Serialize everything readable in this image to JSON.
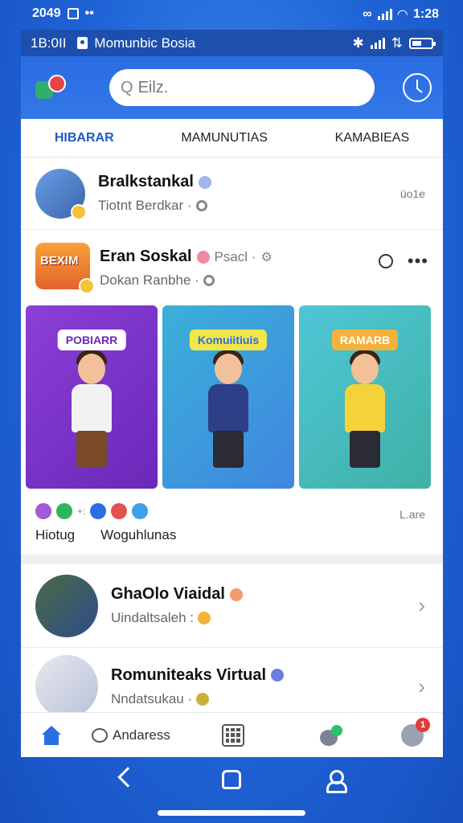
{
  "status_outer": {
    "time": "2049",
    "right_time": "1:28"
  },
  "inner_status": {
    "time": "1B:0II",
    "app_title": "Momunbic Bosia"
  },
  "search": {
    "placeholder": "Eilz."
  },
  "tabs": [
    {
      "label": "HIBARAR",
      "active": true
    },
    {
      "label": "MAMUNUTIAS",
      "active": false
    },
    {
      "label": "KAMABIEAS",
      "active": false
    }
  ],
  "feed": {
    "item1": {
      "title": "Bralkstankal",
      "subtitle": "Tiotnt Berdkar ·",
      "meta": "üo1e"
    },
    "post": {
      "logo_text": "BEXIM",
      "title": "Eran Soskal",
      "tag": "Psacl ·",
      "subtitle": "Dokan Ranbhe ·",
      "cards": [
        {
          "label": "POBIARR"
        },
        {
          "label": "Komuiitiuis"
        },
        {
          "label": "RAMARB"
        }
      ],
      "reaction_labels": [
        "Hiotug",
        "Woguhlunas"
      ],
      "reaction_meta": "L.are"
    },
    "item2": {
      "title": "GhaOlo Viaidal",
      "subtitle": "Uindaltsaleh :"
    },
    "item3": {
      "title": "Romuniteaks Virtual",
      "subtitle": "Nndatsukau ·"
    }
  },
  "bottom_nav": {
    "chat_label": "Andaress",
    "badge": "1"
  },
  "colors": {
    "primary": "#2b6de2",
    "header_dark": "#1c4fae",
    "accent_green": "#28c26a",
    "badge_red": "#e23b3b"
  }
}
